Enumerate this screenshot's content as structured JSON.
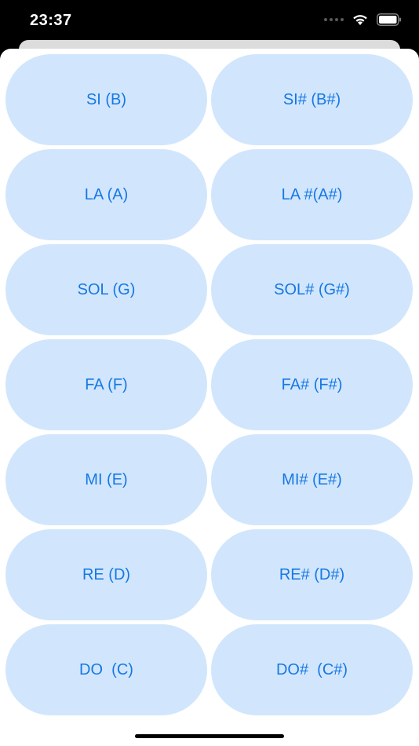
{
  "status": {
    "time": "23:37"
  },
  "notes": [
    {
      "label": "SI (B)"
    },
    {
      "label": "SI# (B#)"
    },
    {
      "label": "LA (A)"
    },
    {
      "label": "LA #(A#)"
    },
    {
      "label": "SOL (G)"
    },
    {
      "label": "SOL# (G#)"
    },
    {
      "label": "FA (F)"
    },
    {
      "label": "FA# (F#)"
    },
    {
      "label": "MI (E)"
    },
    {
      "label": "MI# (E#)"
    },
    {
      "label": "RE (D)"
    },
    {
      "label": "RE# (D#)"
    },
    {
      "label": "DO  (C)"
    },
    {
      "label": "DO#  (C#)"
    }
  ],
  "colors": {
    "button_bg": "#d1e6fd",
    "button_text": "#1778e3"
  }
}
